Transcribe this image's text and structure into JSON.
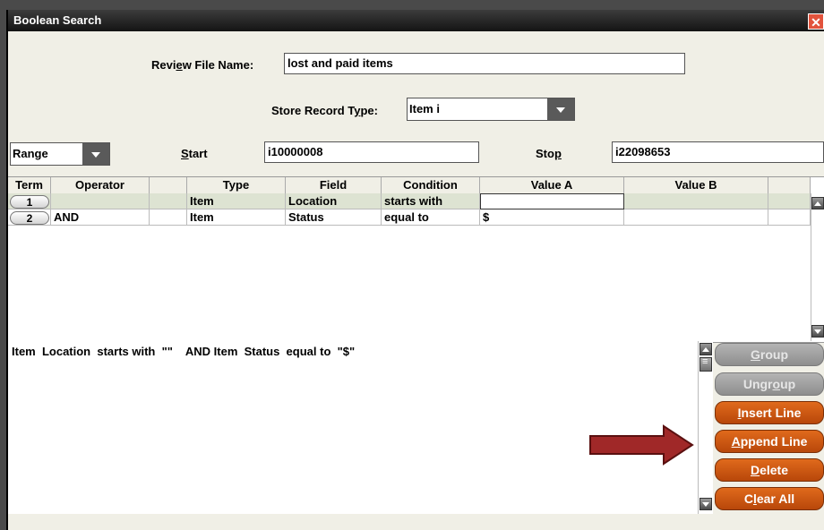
{
  "window": {
    "title": "Boolean Search"
  },
  "review_file": {
    "label_pre": "Revi",
    "label_u": "e",
    "label_mid": "w File Name:",
    "value": "lost and paid items"
  },
  "store_record": {
    "label_pre": "Store Record T",
    "label_u": "y",
    "label_post": "pe:",
    "value": "Item  i"
  },
  "range": {
    "mode": "Range",
    "start_label_u": "S",
    "start_label_rest": "tart",
    "start_value": "i10000008",
    "stop_label_pre": "Sto",
    "stop_label_u": "p",
    "stop_value": "i22098653"
  },
  "grid": {
    "headers": [
      "Term",
      "Operator",
      "",
      "Type",
      "Field",
      "Condition",
      "Value A",
      "Value B",
      ""
    ],
    "rows": [
      {
        "term": "1",
        "operator": "",
        "type": "Item",
        "field": "Location",
        "condition": "starts with",
        "value_a": "",
        "value_b": ""
      },
      {
        "term": "2",
        "operator": "AND",
        "type": "Item",
        "field": "Status",
        "condition": "equal to",
        "value_a": "$",
        "value_b": ""
      }
    ]
  },
  "query_text": "Item  Location  starts with  \"\"    AND Item  Status  equal to  \"$\"",
  "buttons": {
    "group_u": "G",
    "group_rest": "roup",
    "ungroup_pre": "Ungr",
    "ungroup_u": "o",
    "ungroup_rest": "up",
    "insert_u": "I",
    "insert_rest": "nsert Line",
    "append_u": "A",
    "append_rest": "ppend Line",
    "delete_u": "D",
    "delete_rest": "elete",
    "clear_pre": "C",
    "clear_u": "l",
    "clear_rest": "ear All"
  },
  "colors": {
    "action_orange": "#c9560f",
    "arrow_red": "#a02828",
    "row_highlight": "#dde3d2"
  }
}
